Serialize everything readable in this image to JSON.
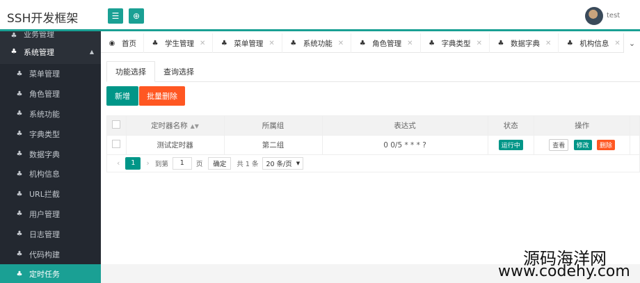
{
  "header": {
    "brand": "SSH开发框架",
    "menu_icon": "menu-icon",
    "refresh_icon": "refresh-icon",
    "username": "test"
  },
  "sidebar": {
    "partial_group": "业务管理",
    "group": {
      "label": "系统管理",
      "icon": "cubes-icon"
    },
    "items": [
      {
        "label": "菜单管理"
      },
      {
        "label": "角色管理"
      },
      {
        "label": "系统功能"
      },
      {
        "label": "字典类型"
      },
      {
        "label": "数据字典"
      },
      {
        "label": "机构信息"
      },
      {
        "label": "URL拦截"
      },
      {
        "label": "用户管理"
      },
      {
        "label": "日志管理"
      },
      {
        "label": "代码构建"
      },
      {
        "label": "定时任务"
      }
    ]
  },
  "tabs": [
    {
      "label": "首页",
      "closable": false
    },
    {
      "label": "学生管理",
      "closable": true
    },
    {
      "label": "菜单管理",
      "closable": true
    },
    {
      "label": "系统功能",
      "closable": true
    },
    {
      "label": "角色管理",
      "closable": true
    },
    {
      "label": "字典类型",
      "closable": true
    },
    {
      "label": "数据字典",
      "closable": true
    },
    {
      "label": "机构信息",
      "closable": true
    }
  ],
  "subtabs": [
    "功能选择",
    "查询选择"
  ],
  "toolbar": {
    "add_label": "新增",
    "batch_delete_label": "批量删除"
  },
  "table": {
    "headers": [
      "定时器名称",
      "所属组",
      "表达式",
      "状态",
      "操作"
    ],
    "rows": [
      {
        "name": "测试定时器",
        "group": "第二组",
        "expression": "0 0/5 * * * ?",
        "status": "运行中",
        "actions": {
          "view": "查看",
          "edit": "修改",
          "delete": "删除"
        }
      }
    ]
  },
  "pager": {
    "current_page": "1",
    "goto_label": "到第",
    "goto_value": "1",
    "page_unit": "页",
    "confirm_label": "确定",
    "total": "共 1 条",
    "page_size": "20 条/页"
  },
  "watermark": {
    "line1": "源码海洋网",
    "line2": "www.codehy.com"
  },
  "colors": {
    "accent": "#1aa094",
    "danger": "#ff5722",
    "sidebar_bg": "#2b3038"
  }
}
